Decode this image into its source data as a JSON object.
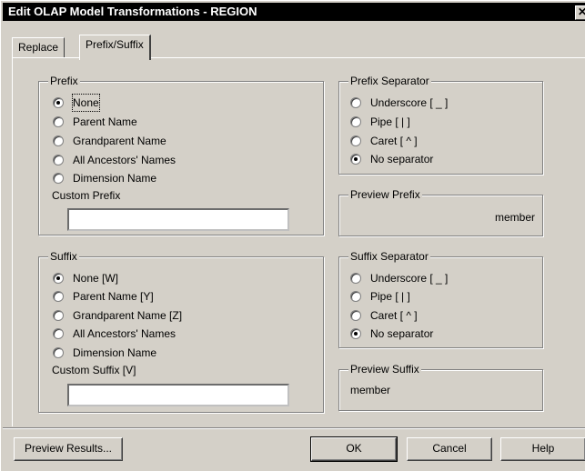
{
  "window": {
    "title": "Edit OLAP Model Transformations - REGION",
    "close_glyph": "✕"
  },
  "tabs": [
    {
      "label": "Replace"
    },
    {
      "label": "Prefix/Suffix"
    }
  ],
  "prefix_group": {
    "label": "Prefix",
    "options": [
      {
        "label": "None",
        "selected": true
      },
      {
        "label": "Parent Name",
        "selected": false
      },
      {
        "label": "Grandparent Name",
        "selected": false
      },
      {
        "label": "All Ancestors' Names",
        "selected": false
      },
      {
        "label": "Dimension Name",
        "selected": false
      }
    ],
    "custom_label": "Custom Prefix",
    "custom_value": ""
  },
  "prefix_separator": {
    "label": "Prefix Separator",
    "options": [
      {
        "label": "Underscore [ _ ]",
        "selected": false
      },
      {
        "label": "Pipe [ | ]",
        "selected": false
      },
      {
        "label": "Caret [ ^ ]",
        "selected": false
      },
      {
        "label": "No separator",
        "selected": true
      }
    ]
  },
  "preview_prefix": {
    "label": "Preview Prefix",
    "value": "member"
  },
  "suffix_group": {
    "label": "Suffix",
    "options": [
      {
        "label": "None [W]",
        "selected": true
      },
      {
        "label": "Parent Name [Y]",
        "selected": false
      },
      {
        "label": "Grandparent Name [Z]",
        "selected": false
      },
      {
        "label": "All Ancestors' Names",
        "selected": false
      },
      {
        "label": "Dimension Name",
        "selected": false
      }
    ],
    "custom_label": "Custom Suffix [V]",
    "custom_value": ""
  },
  "suffix_separator": {
    "label": "Suffix Separator",
    "options": [
      {
        "label": "Underscore [ _ ]",
        "selected": false
      },
      {
        "label": "Pipe [ | ]",
        "selected": false
      },
      {
        "label": "Caret [ ^ ]",
        "selected": false
      },
      {
        "label": "No separator",
        "selected": true
      }
    ]
  },
  "preview_suffix": {
    "label": "Preview Suffix",
    "value": "member"
  },
  "buttons": {
    "preview_results": "Preview Results...",
    "ok": "OK",
    "cancel": "Cancel",
    "help": "Help"
  }
}
